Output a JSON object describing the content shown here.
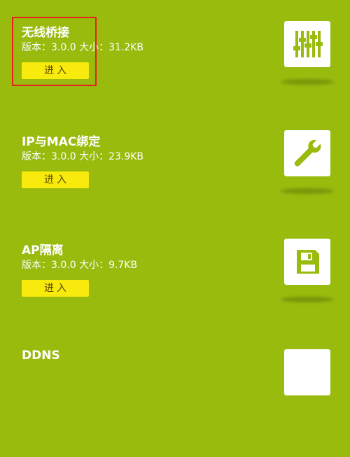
{
  "plugins": [
    {
      "title": "无线桥接",
      "version_label": "版本：",
      "version": "3.0.0",
      "size_label": "大小：",
      "size": "31.2KB",
      "enter_label": "进入",
      "icon": "equalizer-sliders-icon"
    },
    {
      "title": "IP与MAC绑定",
      "version_label": "版本：",
      "version": "3.0.0",
      "size_label": "大小：",
      "size": "23.9KB",
      "enter_label": "进入",
      "icon": "wrench-icon"
    },
    {
      "title": "AP隔离",
      "version_label": "版本：",
      "version": "3.0.0",
      "size_label": "大小：",
      "size": "9.7KB",
      "enter_label": "进入",
      "icon": "floppy-disk-icon"
    },
    {
      "title": "DDNS"
    }
  ],
  "colors": {
    "background": "#98bb0e",
    "button": "#f8ea0c",
    "highlight": "#e8201c",
    "icon": "#98bb0e"
  }
}
